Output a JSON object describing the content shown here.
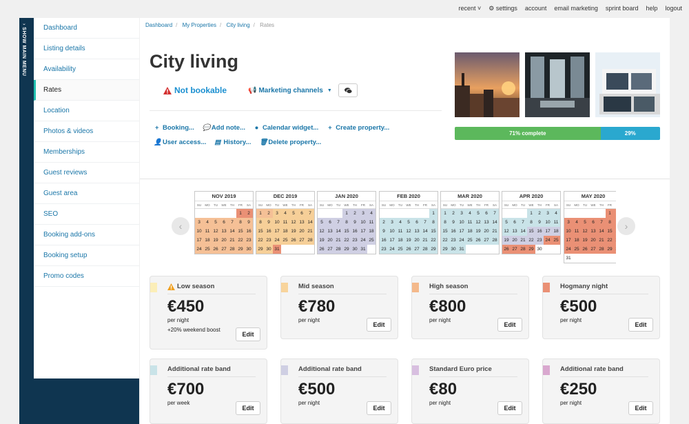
{
  "topnav": [
    "recent ˅",
    "⚙ settings",
    "account",
    "email marketing",
    "sprint board",
    "help",
    "logout"
  ],
  "strip_label": "› SHOW MAIN MENU",
  "sidebar": [
    {
      "label": "Dashboard",
      "active": false
    },
    {
      "label": "Listing details",
      "active": false
    },
    {
      "label": "Availability",
      "active": false
    },
    {
      "label": "Rates",
      "active": true
    },
    {
      "label": "Location",
      "active": false
    },
    {
      "label": "Photos & videos",
      "active": false
    },
    {
      "label": "Memberships",
      "active": false
    },
    {
      "label": "Guest reviews",
      "active": false
    },
    {
      "label": "Guest area",
      "active": false
    },
    {
      "label": "SEO",
      "active": false
    },
    {
      "label": "Booking add-ons",
      "active": false
    },
    {
      "label": "Booking setup",
      "active": false
    },
    {
      "label": "Promo codes",
      "active": false
    }
  ],
  "breadcrumb": {
    "items": [
      "Dashboard",
      "My Properties",
      "City living"
    ],
    "current": "Rates"
  },
  "property": {
    "title": "City living",
    "status": "Not bookable",
    "marketing": "Marketing channels",
    "actions_row1": [
      "Booking...",
      "Add note...",
      "Calendar widget...",
      "Create property..."
    ],
    "actions_row2": [
      "User access...",
      "History...",
      "Delete property..."
    ]
  },
  "progress": {
    "complete_fraction": 0.71,
    "complete_label": "71% complete",
    "remaining_label": "29%"
  },
  "colors": {
    "low": "#f5c096",
    "mid": "#f6cf98",
    "high": "#f4b98b",
    "hogmany": "#ea9075",
    "ar1": "#c9e3e8",
    "ar2": "#cfcfe3",
    "euro": "#d8bfe0",
    "ar3": "#d9a8cf",
    "navy": "#0f3550",
    "link": "#1a76a8",
    "accent": "#20c0b0"
  },
  "calendar": {
    "dow": [
      "SU",
      "MO",
      "TU",
      "WE",
      "TH",
      "FR",
      "SA"
    ],
    "months": [
      {
        "name": "NOV 2019",
        "offset": 5,
        "days": 30,
        "bands": [
          {
            "from": 1,
            "to": 2,
            "c": "hogmany"
          },
          {
            "from": 3,
            "to": 30,
            "c": "low"
          }
        ]
      },
      {
        "name": "DEC 2019",
        "offset": 0,
        "days": 31,
        "bands": [
          {
            "from": 1,
            "to": 2,
            "c": "low"
          },
          {
            "from": 3,
            "to": 30,
            "c": "mid"
          },
          {
            "from": 31,
            "to": 31,
            "c": "hogmany"
          }
        ]
      },
      {
        "name": "JAN 2020",
        "offset": 3,
        "days": 31,
        "bands": [
          {
            "from": 1,
            "to": 31,
            "c": "ar2"
          }
        ]
      },
      {
        "name": "FEB 2020",
        "offset": 6,
        "days": 29,
        "bands": [
          {
            "from": 1,
            "to": 29,
            "c": "ar1"
          }
        ]
      },
      {
        "name": "MAR 2020",
        "offset": 0,
        "days": 31,
        "bands": [
          {
            "from": 1,
            "to": 31,
            "c": "ar1"
          }
        ]
      },
      {
        "name": "APR 2020",
        "offset": 3,
        "days": 30,
        "bands": [
          {
            "from": 1,
            "to": 14,
            "c": "ar1"
          },
          {
            "from": 15,
            "to": 23,
            "c": "ar2"
          },
          {
            "from": 24,
            "to": 25,
            "c": "hogmany"
          },
          {
            "from": 26,
            "to": 29,
            "c": "hogmany"
          },
          {
            "from": 30,
            "to": 30,
            "c": "none"
          }
        ]
      },
      {
        "name": "MAY 2020",
        "offset": 5,
        "days": 31,
        "bands": [
          {
            "from": 1,
            "to": 1,
            "c": "hogmany"
          },
          {
            "from": 2,
            "to": 30,
            "c": "hogmany"
          },
          {
            "from": 31,
            "to": 31,
            "c": "none"
          }
        ]
      }
    ]
  },
  "rates": [
    {
      "name": "Low season",
      "warn": true,
      "price": "€450",
      "per": "per night",
      "extra": "+20% weekend boost",
      "color": "#fbeeb8"
    },
    {
      "name": "Mid season",
      "warn": false,
      "price": "€780",
      "per": "per night",
      "extra": "",
      "color": "#f8d49c"
    },
    {
      "name": "High season",
      "warn": false,
      "price": "€800",
      "per": "per night",
      "extra": "",
      "color": "#f4b98b"
    },
    {
      "name": "Hogmany night",
      "warn": false,
      "price": "€500",
      "per": "per night",
      "extra": "",
      "color": "#ea9075"
    },
    {
      "name": "Additional rate band",
      "warn": false,
      "price": "€700",
      "per": "per week",
      "extra": "",
      "color": "#c9e3e8"
    },
    {
      "name": "Additional rate band",
      "warn": false,
      "price": "€500",
      "per": "per night",
      "extra": "",
      "color": "#cfcfe3"
    },
    {
      "name": "Standard Euro price",
      "warn": false,
      "price": "€80",
      "per": "per night",
      "extra": "",
      "color": "#d8bfe0"
    },
    {
      "name": "Additional rate band",
      "warn": false,
      "price": "€250",
      "per": "per night",
      "extra": "",
      "color": "#d9a8cf"
    }
  ],
  "edit_label": "Edit"
}
